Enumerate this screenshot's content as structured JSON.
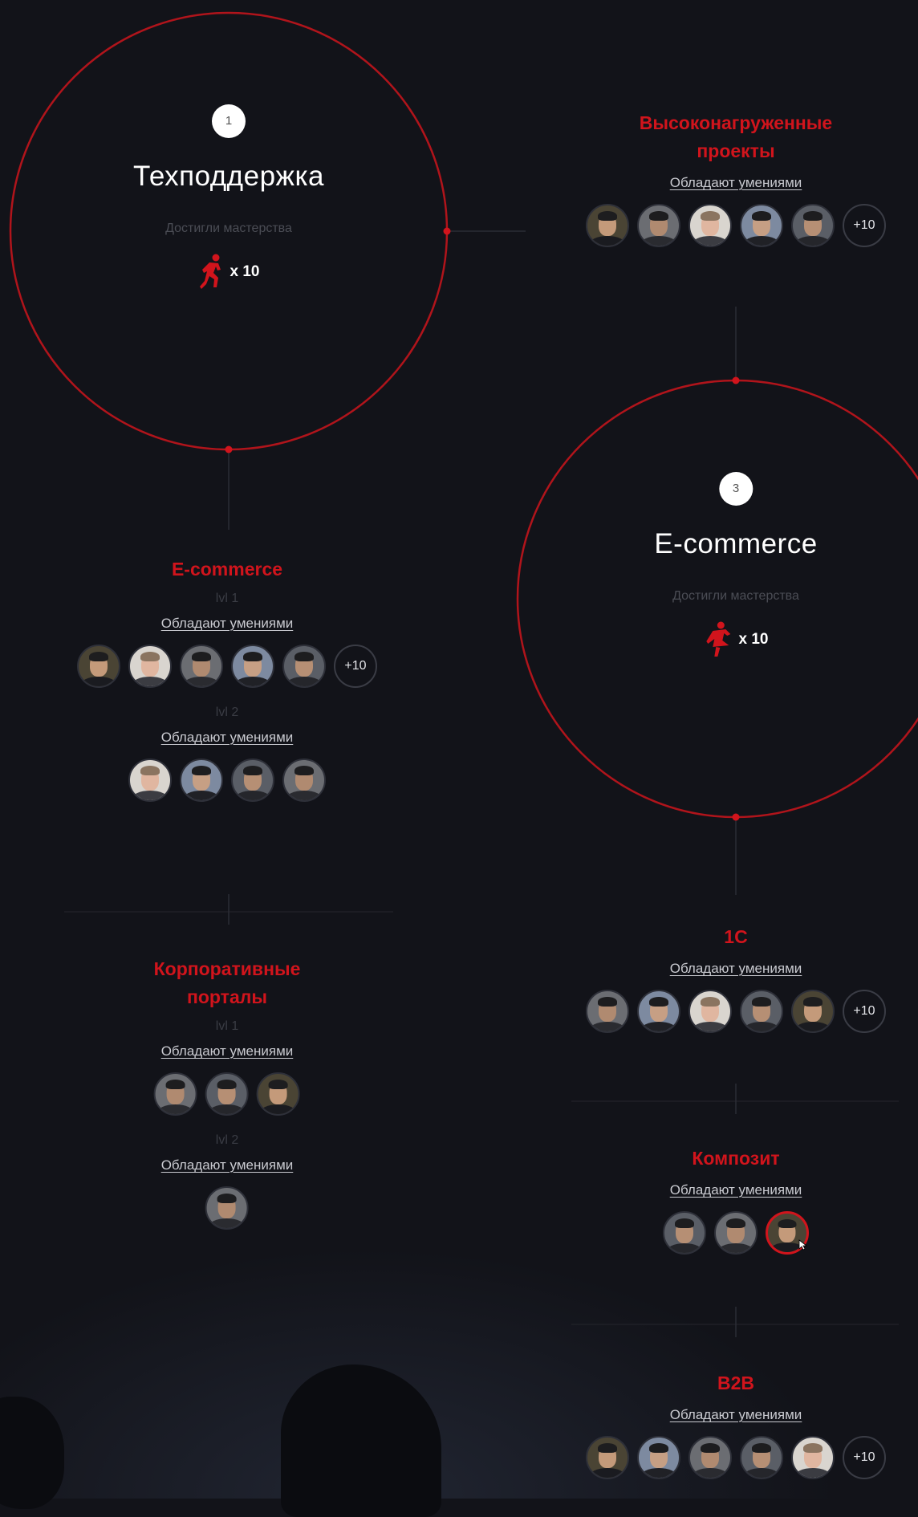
{
  "colors": {
    "background": "#121319",
    "accent": "#d1141c",
    "text_muted": "#4b4d55",
    "link": "#c9cad0"
  },
  "circles": [
    {
      "step": "1",
      "title": "Техподдержка",
      "mastery": "Достигли мастерства",
      "multiplier": "x 10",
      "icon": "runner-icon"
    },
    {
      "step": "3",
      "title": "E-commerce",
      "mastery": "Достигли мастерства",
      "multiplier": "x 10",
      "icon": "runner-icon"
    }
  ],
  "skills": {
    "highload": {
      "title": "Высоконагруженные\nпроекты",
      "owners_label": "Обладают умениями",
      "more": "+10"
    },
    "ecommerce": {
      "title": "E-commerce",
      "lvl1": {
        "label": "lvl 1",
        "owners_label": "Обладают умениями",
        "more": "+10"
      },
      "lvl2": {
        "label": "lvl 2",
        "owners_label": "Обладают умениями"
      }
    },
    "portals": {
      "title": "Корпоративные\nпорталы",
      "lvl1": {
        "label": "lvl 1",
        "owners_label": "Обладают умениями"
      },
      "lvl2": {
        "label": "lvl 2",
        "owners_label": "Обладают умениями"
      }
    },
    "onec": {
      "title": "1С",
      "owners_label": "Обладают умениями",
      "more": "+10"
    },
    "kompozit": {
      "title": "Композит",
      "owners_label": "Обладают умениями"
    },
    "b2b": {
      "title": "B2B",
      "owners_label": "Обладают умениями",
      "more": "+10"
    }
  }
}
